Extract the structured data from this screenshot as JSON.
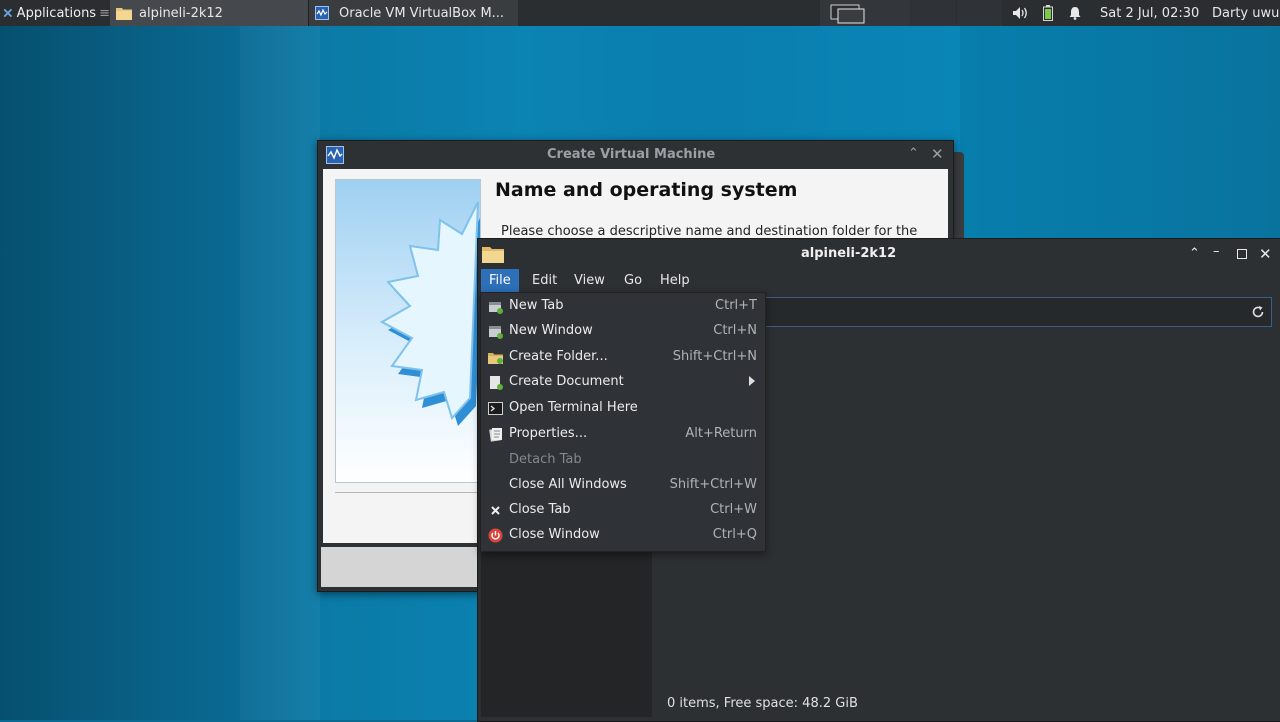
{
  "panel": {
    "apps_label": "Applications",
    "apps_sep": "≡",
    "tasks": [
      {
        "label": "alpineli-2k12"
      },
      {
        "label": "Oracle VM VirtualBox M..."
      }
    ],
    "clock": "Sat  2 Jul, 02:30",
    "user": "Darty uwu"
  },
  "vbox": {
    "title": "Create Virtual Machine",
    "heading": "Name and operating system",
    "text": "Please choose a descriptive name and destination folder for the"
  },
  "fm": {
    "title": "alpineli-2k12",
    "menus": [
      "File",
      "Edit",
      "View",
      "Go",
      "Help"
    ],
    "status": "0 items, Free space: 48.2 GiB"
  },
  "file_menu": {
    "items": [
      {
        "label": "New Tab",
        "accel": "Ctrl+T",
        "icon": "new-tab-icon"
      },
      {
        "label": "New Window",
        "accel": "Ctrl+N",
        "icon": "new-window-icon"
      },
      {
        "label": "Create Folder...",
        "accel": "Shift+Ctrl+N",
        "icon": "create-folder-icon"
      },
      {
        "label": "Create Document",
        "accel": "",
        "icon": "document-icon",
        "submenu": true
      },
      {
        "label": "Open Terminal Here",
        "accel": "",
        "icon": "terminal-icon"
      },
      {
        "label": "Properties...",
        "accel": "Alt+Return",
        "icon": "properties-icon"
      },
      {
        "label": "Detach Tab",
        "accel": "",
        "icon": "",
        "disabled": true
      },
      {
        "label": "Close All Windows",
        "accel": "Shift+Ctrl+W",
        "icon": ""
      },
      {
        "label": "Close Tab",
        "accel": "Ctrl+W",
        "icon": "close-icon"
      },
      {
        "label": "Close Window",
        "accel": "Ctrl+Q",
        "icon": "power-icon"
      }
    ]
  },
  "colors": {
    "accent": "#2d6fb8",
    "panel_bg": "#2b2e31",
    "menu_bg": "#2f3236"
  }
}
